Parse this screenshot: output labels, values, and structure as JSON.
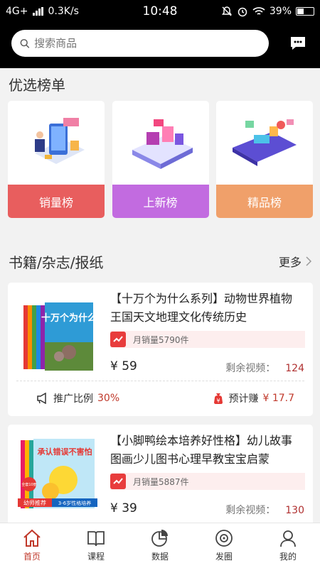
{
  "status_bar": {
    "network": "4G+",
    "speed": "0.3K/s",
    "time": "10:48",
    "battery": "39%"
  },
  "search": {
    "placeholder": "搜索商品"
  },
  "ranking": {
    "title": "优选榜单",
    "cards": [
      {
        "label": "销量榜",
        "color": "#e85e5e"
      },
      {
        "label": "上新榜",
        "color": "#c26be0"
      },
      {
        "label": "精品榜",
        "color": "#f0a06a"
      }
    ]
  },
  "books_section": {
    "title": "书籍/杂志/报纸",
    "more_label": "更多"
  },
  "products": [
    {
      "title": "【十万个为什么系列】动物世界植物王国天文地理文化传统历史",
      "cover_text": "十万个为什么",
      "monthly_sales": "月销量5790件",
      "price": "¥ 59",
      "remaining_label": "剩余视频：",
      "remaining_value": "124",
      "promo_label": "推广比例",
      "promo_value": "30%",
      "earn_label": "预计赚",
      "earn_value": "¥ 17.7"
    },
    {
      "title": "【小脚鸭绘本培养好性格】幼儿故事图画少儿图书心理早教宝宝启蒙",
      "cover_text": "承认错误不害怕",
      "cover_badge1": "全套10册",
      "cover_badge2": "幼师推荐",
      "cover_badge3": "3-6岁性格培养",
      "monthly_sales": "月销量5887件",
      "price": "¥ 39",
      "remaining_label": "剩余视频：",
      "remaining_value": "130"
    }
  ],
  "nav": [
    {
      "label": "首页",
      "active": true
    },
    {
      "label": "课程"
    },
    {
      "label": "数据"
    },
    {
      "label": "发圈"
    },
    {
      "label": "我的"
    }
  ]
}
